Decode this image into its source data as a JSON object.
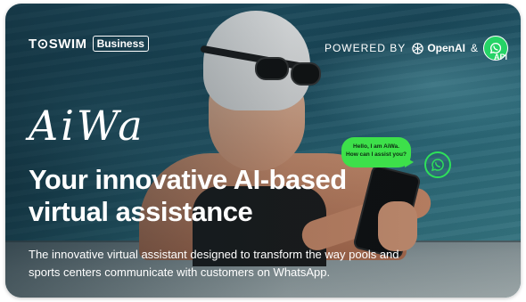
{
  "header": {
    "brand_name": "T⊙SWIM",
    "brand_badge": "Business",
    "powered_by": "POWERED BY",
    "openai_label": "OpenAI",
    "ampersand": "&",
    "api_label": "API"
  },
  "hero": {
    "product_name": "AiWa",
    "headline_line1": "Your innovative AI-based",
    "headline_line2": "virtual assistance",
    "description": "The innovative virtual assistant designed to transform the way pools and sports centers communicate with customers on WhatsApp."
  },
  "chat": {
    "line1": "Hello, I am AiWa.",
    "line2": "How can I assist you?"
  },
  "colors": {
    "whatsapp_green": "#25d366",
    "bubble_green": "#3de04a",
    "text": "#ffffff"
  },
  "icons": [
    "openai-icon",
    "whatsapp-icon",
    "whatsapp-icon"
  ]
}
